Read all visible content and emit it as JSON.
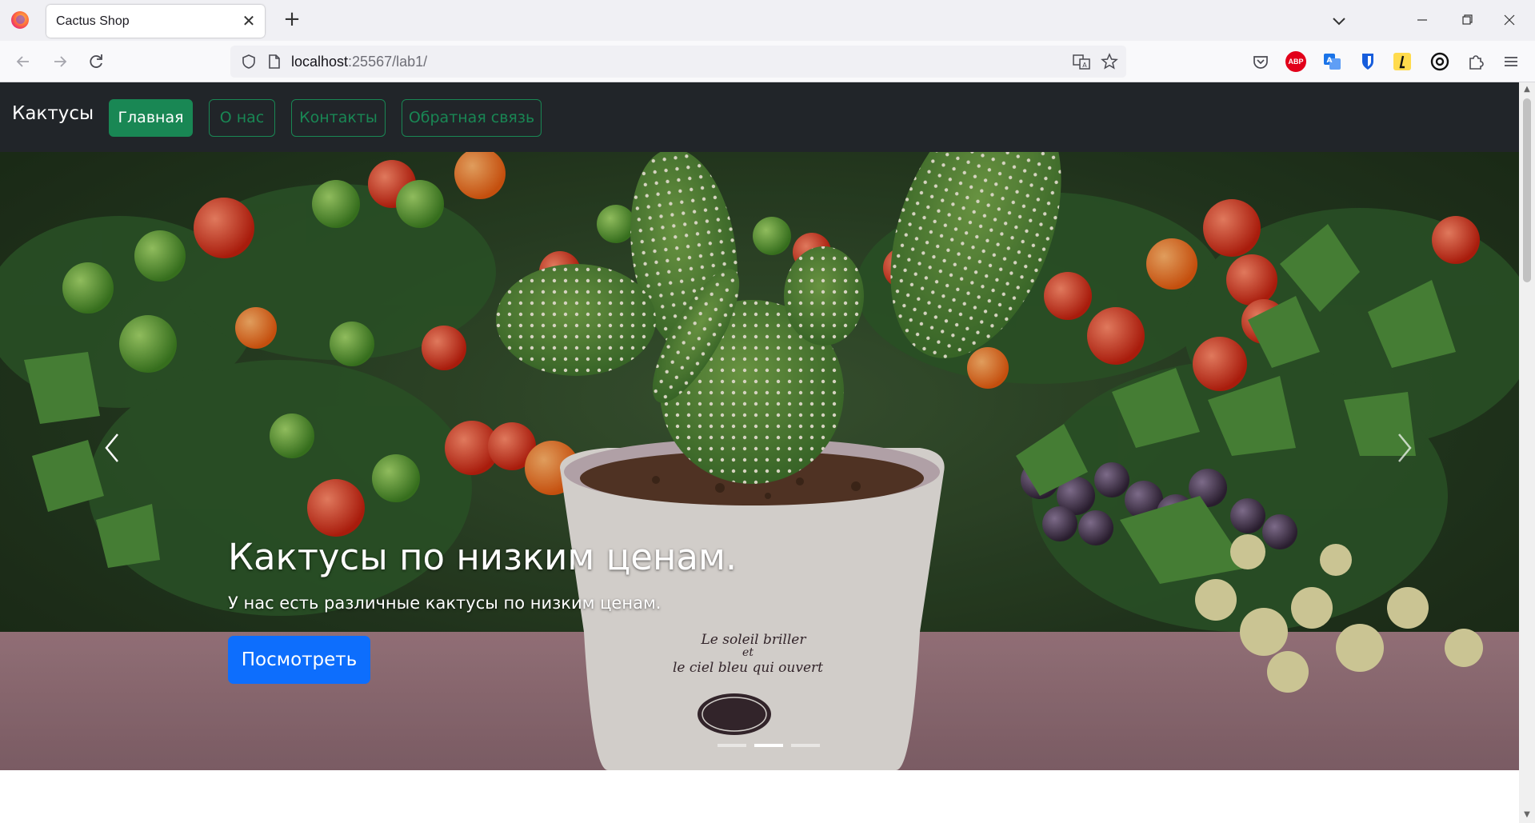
{
  "browser": {
    "tab_title": "Cactus Shop",
    "url_host": "localhost",
    "url_rest": ":25567/lab1/",
    "ext_abp": "ABP"
  },
  "site": {
    "brand": "Кактусы",
    "nav": [
      {
        "label": "Главная",
        "active": true
      },
      {
        "label": "О нас",
        "active": false
      },
      {
        "label": "Контакты",
        "active": false
      },
      {
        "label": "Обратная связь",
        "active": false
      }
    ]
  },
  "carousel": {
    "title": "Кактусы по низким ценам.",
    "text": "У нас есть различные кактусы по низким ценам.",
    "button": "Посмотреть",
    "pot_text_1": "Le soleil briller",
    "pot_text_2": "et",
    "pot_text_3": "le ciel bleu qui ouvert",
    "indicators": 3,
    "active_indicator": 1
  },
  "colors": {
    "navbar_bg": "#212529",
    "success": "#198754",
    "primary": "#0d6efd"
  }
}
